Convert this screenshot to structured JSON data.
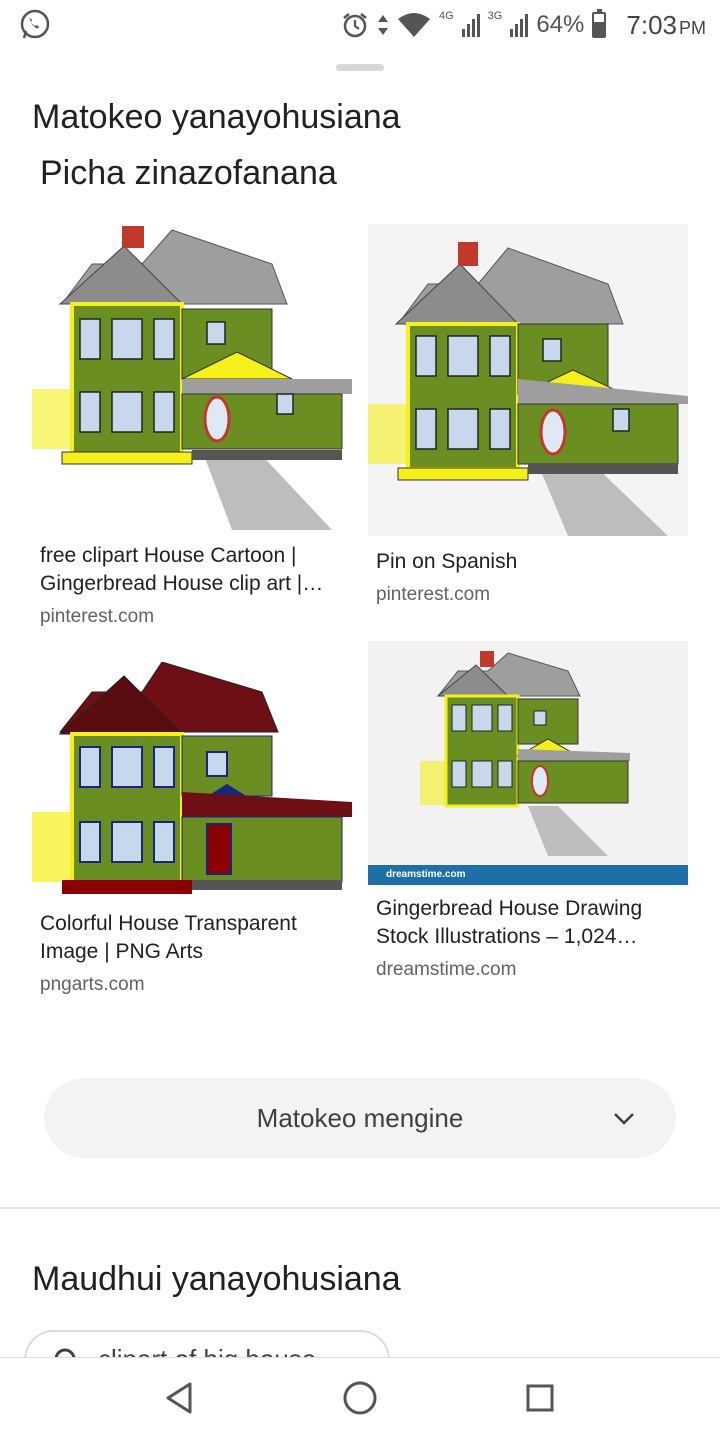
{
  "status_bar": {
    "battery_percent": "64%",
    "time": "7:03",
    "ampm": "PM",
    "network_1": "4G",
    "network_2": "3G",
    "icons": [
      "whatsapp-icon",
      "alarm-icon",
      "data-arrows-icon",
      "wifi-icon",
      "signal-icon",
      "battery-icon"
    ]
  },
  "section_related_results": {
    "heading": "Matokeo yanayohusiana",
    "subheading": "Picha zinazofanana"
  },
  "images": [
    {
      "title": "free clipart House Cartoon | Gingerbread House clip art |…",
      "source": "pinterest.com",
      "roof_color": "#9e9e9e",
      "trim_color": "#f5ef1a",
      "wall_color": "#6b8e23"
    },
    {
      "title": "Pin on Spanish",
      "source": "pinterest.com",
      "roof_color": "#9e9e9e",
      "trim_color": "#f5ef1a",
      "wall_color": "#6b8e23"
    },
    {
      "title": "Colorful House Transparent Image | PNG Arts",
      "source": "pngarts.com",
      "roof_color": "#6d0f14",
      "trim_color": "#f5ef1a",
      "wall_color": "#6b8e23"
    },
    {
      "title": "Gingerbread House Drawing Stock Illustrations – 1,024…",
      "source": "dreamstime.com",
      "roof_color": "#9e9e9e",
      "trim_color": "#f5ef1a",
      "wall_color": "#6b8e23",
      "watermark": "dreamstime.com"
    }
  ],
  "more_button": {
    "label": "Matokeo mengine"
  },
  "section_related_topics": {
    "heading": "Maudhui yanayohusiana",
    "chip_text": "clipart of big house"
  },
  "colors": {
    "accent_bg": "#f1f3f4",
    "text": "#202124",
    "muted": "#5f6368"
  }
}
